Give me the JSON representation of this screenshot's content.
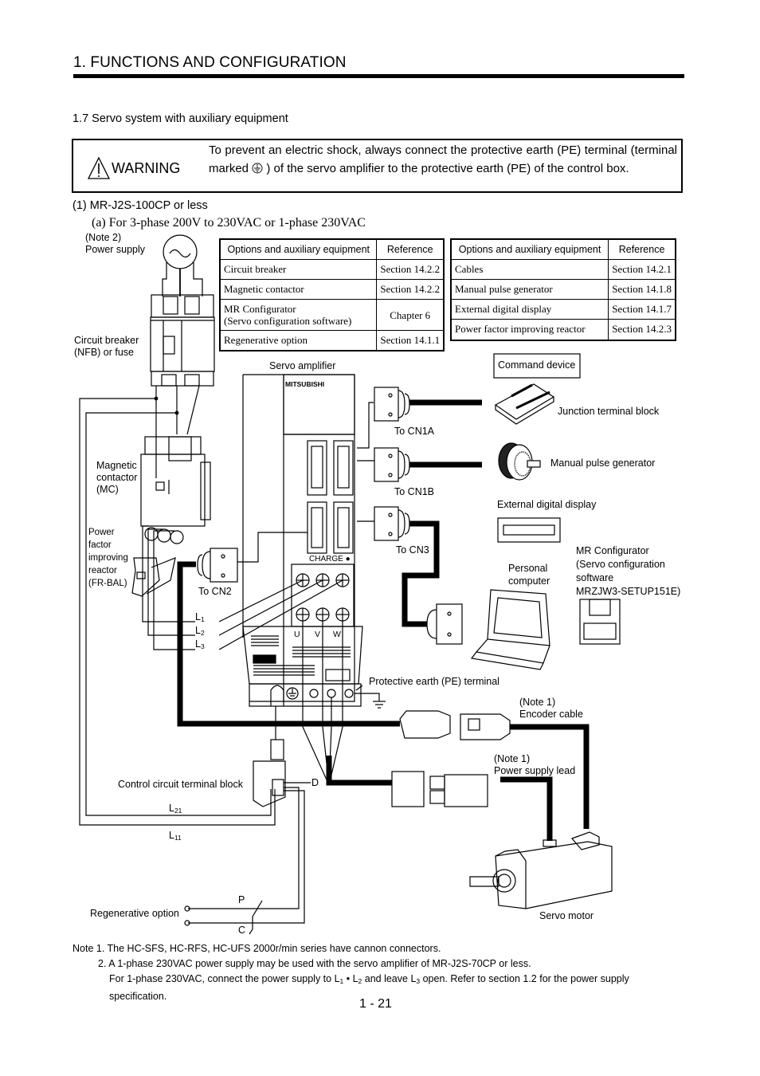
{
  "header": {
    "chapter_title": "1. FUNCTIONS AND CONFIGURATION"
  },
  "section": {
    "title": "1.7 Servo system with auxiliary equipment"
  },
  "warning": {
    "icon": "warning-triangle-icon",
    "label": "WARNING",
    "text_part1": "To prevent an electric shock, always connect the protective earth (PE) terminal (terminal marked",
    "earth_symbol": "earth-terminal-icon",
    "text_part2": ") of the servo amplifier to the protective earth (PE) of the control box."
  },
  "subsection": {
    "title": "(1) MR-J2S-100CP or less",
    "subtitle": "(a) For 3-phase 200V to 230VAC or 1-phase 230VAC"
  },
  "tables": {
    "left": {
      "headers": [
        "Options and auxiliary equipment",
        "Reference"
      ],
      "rows": [
        {
          "item": "Circuit breaker",
          "ref": "Section 14.2.2"
        },
        {
          "item": "Magnetic contactor",
          "ref": "Section 14.2.2"
        },
        {
          "item_line1": "MR Configurator",
          "item_line2": "(Servo configuration software)",
          "ref": "Chapter 6"
        },
        {
          "item": "Regenerative option",
          "ref": "Section 14.1.1"
        }
      ]
    },
    "right": {
      "headers": [
        "Options and auxiliary equipment",
        "Reference"
      ],
      "rows": [
        {
          "item": "Cables",
          "ref": "Section 14.2.1"
        },
        {
          "item": "Manual pulse generator",
          "ref": "Section 14.1.8"
        },
        {
          "item": "External digital display",
          "ref": "Section 14.1.7"
        },
        {
          "item": "Power factor improving reactor",
          "ref": "Section 14.2.3"
        }
      ]
    }
  },
  "diagram": {
    "power_supply": {
      "note": "(Note 2)",
      "label": "Power supply"
    },
    "circuit_breaker": {
      "line1": "Circuit breaker",
      "line2": "(NFB) or fuse"
    },
    "magnetic_contactor": {
      "line1": "Magnetic",
      "line2": "contactor",
      "line3": "(MC)"
    },
    "reactor": {
      "line1": "Power",
      "line2": "factor",
      "line3": "improving",
      "line4": "reactor",
      "line5": "(FR-BAL)"
    },
    "servo_amplifier": {
      "label": "Servo amplifier",
      "brand": "MITSUBISHI",
      "charge": "CHARGE"
    },
    "connectors": {
      "cn1a": "To CN1A",
      "cn1b": "To CN1B",
      "cn3": "To CN3",
      "cn2": "To CN2"
    },
    "phases": {
      "l1": "L",
      "l1_sub": "1",
      "l2": "L",
      "l2_sub": "2",
      "l3": "L",
      "l3_sub": "3"
    },
    "outputs": {
      "u": "U",
      "v": "V",
      "w": "W"
    },
    "command_device": "Command device",
    "junction_terminal_block": "Junction terminal block",
    "manual_pulse_generator": "Manual pulse generator",
    "external_digital_display": "External digital display",
    "personal_computer": {
      "line1": "Personal",
      "line2": "computer"
    },
    "mr_configurator": {
      "line1": "MR Configurator",
      "line2": "(Servo configuration",
      "line3": "software",
      "line4": "MRZJW3-SETUP151E)"
    },
    "pe_terminal": "Protective earth (PE) terminal",
    "encoder_cable": {
      "note": "(Note 1)",
      "label": "Encoder cable"
    },
    "power_supply_lead": {
      "note": "(Note 1)",
      "label": "Power supply lead"
    },
    "control_terminal_block": "Control circuit terminal block",
    "terminal_d": "D",
    "l21": "L",
    "l21_sub": "21",
    "l11": "L",
    "l11_sub": "11",
    "regenerative_option": "Regenerative option",
    "terminal_p": "P",
    "terminal_c": "C",
    "servo_motor": "Servo motor"
  },
  "notes": {
    "note1": "Note 1. The HC-SFS, HC-RFS, HC-UFS 2000r/min series have cannon connectors.",
    "note2_line1": "2. A 1-phase 230VAC power supply may be used with the servo amplifier of MR-J2S-70CP or less.",
    "note2_line2_a": "For 1-phase 230VAC, connect the power supply to L",
    "note2_line2_b": " • L",
    "note2_line2_c": " and leave L",
    "note2_line2_d": " open. Refer to section 1.2 for the power supply",
    "note2_sub1": "1",
    "note2_sub2": "2",
    "note2_sub3": "3",
    "note2_line3": "specification."
  },
  "footer": {
    "page_number": "1 -  21"
  }
}
